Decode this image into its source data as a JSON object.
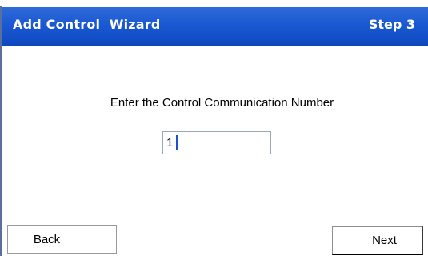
{
  "wizard": {
    "title": "Add Control  Wizard",
    "step": "Step 3"
  },
  "content": {
    "prompt": "Enter the Control Communication Number",
    "communication_number": "1"
  },
  "buttons": {
    "back_label": "Back",
    "next_label": "Next"
  },
  "colors": {
    "title_bar": "#1a59d2",
    "title_text": "#ffffff",
    "background": "#ffffff"
  }
}
